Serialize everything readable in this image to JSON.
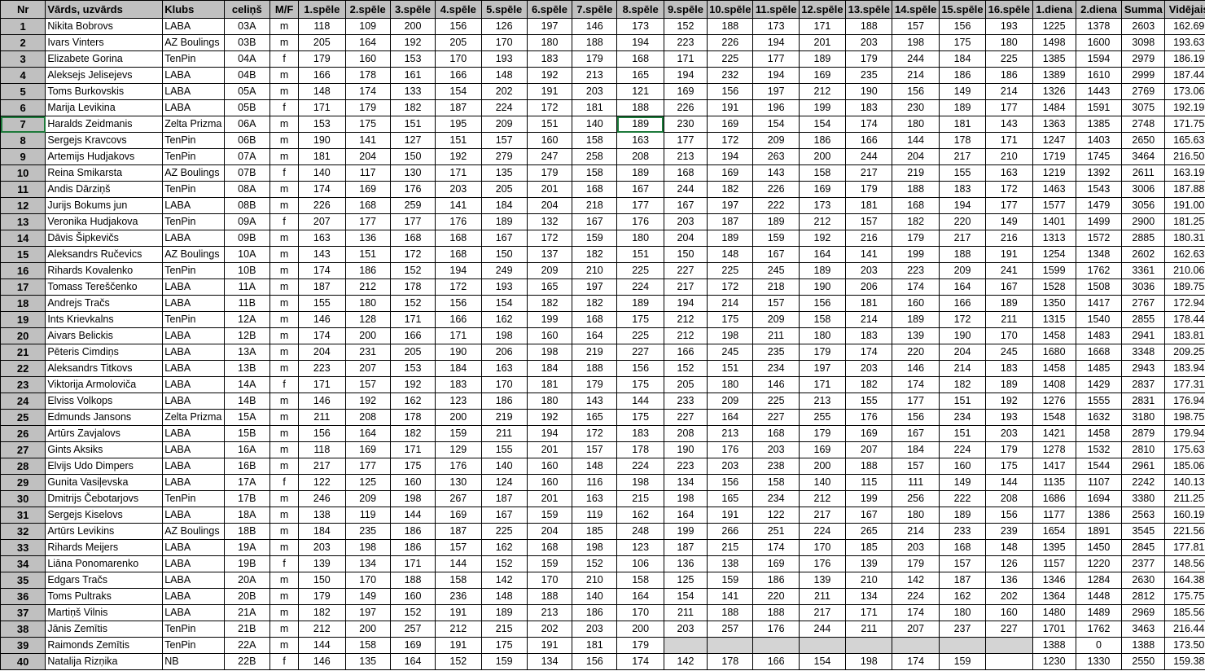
{
  "headers": [
    "Nr",
    "Vārds, uzvārds",
    "Klubs",
    "celiņš",
    "M/F",
    "1.spēle",
    "2.spēle",
    "3.spēle",
    "4.spēle",
    "5.spēle",
    "6.spēle",
    "7.spēle",
    "8.spēle",
    "9.spēle",
    "10.spēle",
    "11.spēle",
    "12.spēle",
    "13.spēle",
    "14.spēle",
    "15.spēle",
    "16.spēle",
    "1.diena",
    "2.diena",
    "Summa",
    "Vidējais"
  ],
  "rows": [
    [
      "1",
      "Nikita Bobrovs",
      "LABA",
      "03A",
      "m",
      "118",
      "109",
      "200",
      "156",
      "126",
      "197",
      "146",
      "173",
      "152",
      "188",
      "173",
      "171",
      "188",
      "157",
      "156",
      "193",
      "1225",
      "1378",
      "2603",
      "162.69"
    ],
    [
      "2",
      "Ivars Vinters",
      "AZ Boulings",
      "03B",
      "m",
      "205",
      "164",
      "192",
      "205",
      "170",
      "180",
      "188",
      "194",
      "223",
      "226",
      "194",
      "201",
      "203",
      "198",
      "175",
      "180",
      "1498",
      "1600",
      "3098",
      "193.63"
    ],
    [
      "3",
      "Elizabete Gorina",
      "TenPin",
      "04A",
      "f",
      "179",
      "160",
      "153",
      "170",
      "193",
      "183",
      "179",
      "168",
      "171",
      "225",
      "177",
      "189",
      "179",
      "244",
      "184",
      "225",
      "1385",
      "1594",
      "2979",
      "186.19"
    ],
    [
      "4",
      "Aleksejs Jelisejevs",
      "LABA",
      "04B",
      "m",
      "166",
      "178",
      "161",
      "166",
      "148",
      "192",
      "213",
      "165",
      "194",
      "232",
      "194",
      "169",
      "235",
      "214",
      "186",
      "186",
      "1389",
      "1610",
      "2999",
      "187.44"
    ],
    [
      "5",
      "Toms Burkovskis",
      "LABA",
      "05A",
      "m",
      "148",
      "174",
      "133",
      "154",
      "202",
      "191",
      "203",
      "121",
      "169",
      "156",
      "197",
      "212",
      "190",
      "156",
      "149",
      "214",
      "1326",
      "1443",
      "2769",
      "173.06"
    ],
    [
      "6",
      "Marija Levikina",
      "LABA",
      "05B",
      "f",
      "171",
      "179",
      "182",
      "187",
      "224",
      "172",
      "181",
      "188",
      "226",
      "191",
      "196",
      "199",
      "183",
      "230",
      "189",
      "177",
      "1484",
      "1591",
      "3075",
      "192.19"
    ],
    [
      "7",
      "Haralds Zeidmanis",
      "Zelta Prizma",
      "06A",
      "m",
      "153",
      "175",
      "151",
      "195",
      "209",
      "151",
      "140",
      "189",
      "230",
      "169",
      "154",
      "154",
      "174",
      "180",
      "181",
      "143",
      "1363",
      "1385",
      "2748",
      "171.75"
    ],
    [
      "8",
      "Sergejs Kravcovs",
      "TenPin",
      "06B",
      "m",
      "190",
      "141",
      "127",
      "151",
      "157",
      "160",
      "158",
      "163",
      "177",
      "172",
      "209",
      "186",
      "166",
      "144",
      "178",
      "171",
      "1247",
      "1403",
      "2650",
      "165.63"
    ],
    [
      "9",
      "Artemijs Hudjakovs",
      "TenPin",
      "07A",
      "m",
      "181",
      "204",
      "150",
      "192",
      "279",
      "247",
      "258",
      "208",
      "213",
      "194",
      "263",
      "200",
      "244",
      "204",
      "217",
      "210",
      "1719",
      "1745",
      "3464",
      "216.50"
    ],
    [
      "10",
      "Reina Smikarsta",
      "AZ Boulings",
      "07B",
      "f",
      "140",
      "117",
      "130",
      "171",
      "135",
      "179",
      "158",
      "189",
      "168",
      "169",
      "143",
      "158",
      "217",
      "219",
      "155",
      "163",
      "1219",
      "1392",
      "2611",
      "163.19"
    ],
    [
      "11",
      "Andis Dārziņš",
      "TenPin",
      "08A",
      "m",
      "174",
      "169",
      "176",
      "203",
      "205",
      "201",
      "168",
      "167",
      "244",
      "182",
      "226",
      "169",
      "179",
      "188",
      "183",
      "172",
      "1463",
      "1543",
      "3006",
      "187.88"
    ],
    [
      "12",
      "Jurijs Bokums jun",
      "LABA",
      "08B",
      "m",
      "226",
      "168",
      "259",
      "141",
      "184",
      "204",
      "218",
      "177",
      "167",
      "197",
      "222",
      "173",
      "181",
      "168",
      "194",
      "177",
      "1577",
      "1479",
      "3056",
      "191.00"
    ],
    [
      "13",
      "Veronika Hudjakova",
      "TenPin",
      "09A",
      "f",
      "207",
      "177",
      "177",
      "176",
      "189",
      "132",
      "167",
      "176",
      "203",
      "187",
      "189",
      "212",
      "157",
      "182",
      "220",
      "149",
      "1401",
      "1499",
      "2900",
      "181.25"
    ],
    [
      "14",
      "Dāvis Šipkevičs",
      "LABA",
      "09B",
      "m",
      "163",
      "136",
      "168",
      "168",
      "167",
      "172",
      "159",
      "180",
      "204",
      "189",
      "159",
      "192",
      "216",
      "179",
      "217",
      "216",
      "1313",
      "1572",
      "2885",
      "180.31"
    ],
    [
      "15",
      "Aleksandrs Ručevics",
      "AZ Boulings",
      "10A",
      "m",
      "143",
      "151",
      "172",
      "168",
      "150",
      "137",
      "182",
      "151",
      "150",
      "148",
      "167",
      "164",
      "141",
      "199",
      "188",
      "191",
      "1254",
      "1348",
      "2602",
      "162.63"
    ],
    [
      "16",
      "Rihards Kovalenko",
      "TenPin",
      "10B",
      "m",
      "174",
      "186",
      "152",
      "194",
      "249",
      "209",
      "210",
      "225",
      "227",
      "225",
      "245",
      "189",
      "203",
      "223",
      "209",
      "241",
      "1599",
      "1762",
      "3361",
      "210.06"
    ],
    [
      "17",
      "Tomass Tereščenko",
      "LABA",
      "11A",
      "m",
      "187",
      "212",
      "178",
      "172",
      "193",
      "165",
      "197",
      "224",
      "217",
      "172",
      "218",
      "190",
      "206",
      "174",
      "164",
      "167",
      "1528",
      "1508",
      "3036",
      "189.75"
    ],
    [
      "18",
      "Andrejs Tračs",
      "LABA",
      "11B",
      "m",
      "155",
      "180",
      "152",
      "156",
      "154",
      "182",
      "182",
      "189",
      "194",
      "214",
      "157",
      "156",
      "181",
      "160",
      "166",
      "189",
      "1350",
      "1417",
      "2767",
      "172.94"
    ],
    [
      "19",
      "Ints Krievkalns",
      "TenPin",
      "12A",
      "m",
      "146",
      "128",
      "171",
      "166",
      "162",
      "199",
      "168",
      "175",
      "212",
      "175",
      "209",
      "158",
      "214",
      "189",
      "172",
      "211",
      "1315",
      "1540",
      "2855",
      "178.44"
    ],
    [
      "20",
      "Aivars Belickis",
      "LABA",
      "12B",
      "m",
      "174",
      "200",
      "166",
      "171",
      "198",
      "160",
      "164",
      "225",
      "212",
      "198",
      "211",
      "180",
      "183",
      "139",
      "190",
      "170",
      "1458",
      "1483",
      "2941",
      "183.81"
    ],
    [
      "21",
      "Pēteris Cimdiņs",
      "LABA",
      "13A",
      "m",
      "204",
      "231",
      "205",
      "190",
      "206",
      "198",
      "219",
      "227",
      "166",
      "245",
      "235",
      "179",
      "174",
      "220",
      "204",
      "245",
      "1680",
      "1668",
      "3348",
      "209.25"
    ],
    [
      "22",
      "Aleksandrs Titkovs",
      "LABA",
      "13B",
      "m",
      "223",
      "207",
      "153",
      "184",
      "163",
      "184",
      "188",
      "156",
      "152",
      "151",
      "234",
      "197",
      "203",
      "146",
      "214",
      "183",
      "1458",
      "1485",
      "2943",
      "183.94"
    ],
    [
      "23",
      "Viktorija Armolovičа",
      "LABA",
      "14A",
      "f",
      "171",
      "157",
      "192",
      "183",
      "170",
      "181",
      "179",
      "175",
      "205",
      "180",
      "146",
      "171",
      "182",
      "174",
      "182",
      "189",
      "1408",
      "1429",
      "2837",
      "177.31"
    ],
    [
      "24",
      "Elviss Volkops",
      "LABA",
      "14B",
      "m",
      "146",
      "192",
      "162",
      "123",
      "186",
      "180",
      "143",
      "144",
      "233",
      "209",
      "225",
      "213",
      "155",
      "177",
      "151",
      "192",
      "1276",
      "1555",
      "2831",
      "176.94"
    ],
    [
      "25",
      "Edmunds Jansons",
      "Zelta Prizma",
      "15A",
      "m",
      "211",
      "208",
      "178",
      "200",
      "219",
      "192",
      "165",
      "175",
      "227",
      "164",
      "227",
      "255",
      "176",
      "156",
      "234",
      "193",
      "1548",
      "1632",
      "3180",
      "198.75"
    ],
    [
      "26",
      "Artūrs Zavjalovs",
      "LABA",
      "15B",
      "m",
      "156",
      "164",
      "182",
      "159",
      "211",
      "194",
      "172",
      "183",
      "208",
      "213",
      "168",
      "179",
      "169",
      "167",
      "151",
      "203",
      "1421",
      "1458",
      "2879",
      "179.94"
    ],
    [
      "27",
      "Gints Aksiks",
      "LABA",
      "16A",
      "m",
      "118",
      "169",
      "171",
      "129",
      "155",
      "201",
      "157",
      "178",
      "190",
      "176",
      "203",
      "169",
      "207",
      "184",
      "224",
      "179",
      "1278",
      "1532",
      "2810",
      "175.63"
    ],
    [
      "28",
      "Elvijs Udo Dimpers",
      "LABA",
      "16B",
      "m",
      "217",
      "177",
      "175",
      "176",
      "140",
      "160",
      "148",
      "224",
      "223",
      "203",
      "238",
      "200",
      "188",
      "157",
      "160",
      "175",
      "1417",
      "1544",
      "2961",
      "185.06"
    ],
    [
      "29",
      "Gunita Vasiļevska",
      "LABA",
      "17A",
      "f",
      "122",
      "125",
      "160",
      "130",
      "124",
      "160",
      "116",
      "198",
      "134",
      "156",
      "158",
      "140",
      "115",
      "111",
      "149",
      "144",
      "1135",
      "1107",
      "2242",
      "140.13"
    ],
    [
      "30",
      "Dmitrijs Čebotarjovs",
      "TenPin",
      "17B",
      "m",
      "246",
      "209",
      "198",
      "267",
      "187",
      "201",
      "163",
      "215",
      "198",
      "165",
      "234",
      "212",
      "199",
      "256",
      "222",
      "208",
      "1686",
      "1694",
      "3380",
      "211.25"
    ],
    [
      "31",
      "Sergejs Kiselovs",
      "LABA",
      "18A",
      "m",
      "138",
      "119",
      "144",
      "169",
      "167",
      "159",
      "119",
      "162",
      "164",
      "191",
      "122",
      "217",
      "167",
      "180",
      "189",
      "156",
      "1177",
      "1386",
      "2563",
      "160.19"
    ],
    [
      "32",
      "Artūrs Levikins",
      "AZ Boulings",
      "18B",
      "m",
      "184",
      "235",
      "186",
      "187",
      "225",
      "204",
      "185",
      "248",
      "199",
      "266",
      "251",
      "224",
      "265",
      "214",
      "233",
      "239",
      "1654",
      "1891",
      "3545",
      "221.56"
    ],
    [
      "33",
      "Rihards Meijers",
      "LABA",
      "19A",
      "m",
      "203",
      "198",
      "186",
      "157",
      "162",
      "168",
      "198",
      "123",
      "187",
      "215",
      "174",
      "170",
      "185",
      "203",
      "168",
      "148",
      "1395",
      "1450",
      "2845",
      "177.81"
    ],
    [
      "34",
      "Liāna Ponomarenko",
      "LABA",
      "19B",
      "f",
      "139",
      "134",
      "171",
      "144",
      "152",
      "159",
      "152",
      "106",
      "136",
      "138",
      "169",
      "176",
      "139",
      "179",
      "157",
      "126",
      "1157",
      "1220",
      "2377",
      "148.56"
    ],
    [
      "35",
      "Edgars Tračs",
      "LABA",
      "20A",
      "m",
      "150",
      "170",
      "188",
      "158",
      "142",
      "170",
      "210",
      "158",
      "125",
      "159",
      "186",
      "139",
      "210",
      "142",
      "187",
      "136",
      "1346",
      "1284",
      "2630",
      "164.38"
    ],
    [
      "36",
      "Toms Pultraks",
      "LABA",
      "20B",
      "m",
      "179",
      "149",
      "160",
      "236",
      "148",
      "188",
      "140",
      "164",
      "154",
      "141",
      "220",
      "211",
      "134",
      "224",
      "162",
      "202",
      "1364",
      "1448",
      "2812",
      "175.75"
    ],
    [
      "37",
      "Martiņš Vilnis",
      "LABA",
      "21A",
      "m",
      "182",
      "197",
      "152",
      "191",
      "189",
      "213",
      "186",
      "170",
      "211",
      "188",
      "188",
      "217",
      "171",
      "174",
      "180",
      "160",
      "1480",
      "1489",
      "2969",
      "185.56"
    ],
    [
      "38",
      "Jānis Zemītis",
      "TenPin",
      "21B",
      "m",
      "212",
      "200",
      "257",
      "212",
      "215",
      "202",
      "203",
      "200",
      "203",
      "257",
      "176",
      "244",
      "211",
      "207",
      "237",
      "227",
      "1701",
      "1762",
      "3463",
      "216.44"
    ],
    [
      "39",
      "Raimonds Zemītis",
      "TenPin",
      "22A",
      "m",
      "144",
      "158",
      "169",
      "191",
      "175",
      "191",
      "181",
      "179",
      "",
      "",
      "",
      "",
      "",
      "",
      "",
      "",
      "1388",
      "0",
      "1388",
      "173.50"
    ],
    [
      "40",
      "Natalija Rizņika",
      "NB",
      "22B",
      "f",
      "146",
      "135",
      "164",
      "152",
      "159",
      "134",
      "156",
      "174",
      "142",
      "178",
      "166",
      "154",
      "198",
      "174",
      "159",
      "",
      "1230",
      "1330",
      "2550",
      "159.38"
    ]
  ]
}
